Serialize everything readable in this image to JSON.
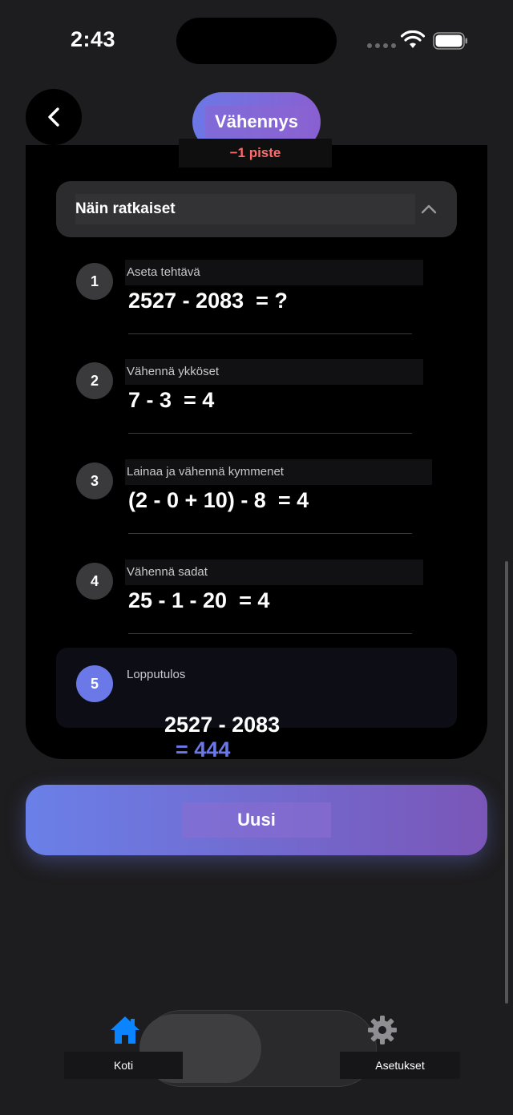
{
  "status_bar": {
    "time": "2:43"
  },
  "header": {
    "title": "Vähennys",
    "penalty": "−1 piste"
  },
  "solution": {
    "accordion_title": "Näin ratkaiset",
    "steps": [
      {
        "number": "1",
        "label": "Aseta tehtävä",
        "equation": "2527 - 2083  = ?"
      },
      {
        "number": "2",
        "label": "Vähennä ykköset",
        "equation": "7 - 3  = 4"
      },
      {
        "number": "3",
        "label": "Lainaa ja vähennä kymmenet",
        "equation": "(2 - 0 + 10) - 8  = 4"
      },
      {
        "number": "4",
        "label": "Vähennä sadat",
        "equation": "25 - 1 - 20  = 4"
      }
    ],
    "final": {
      "number": "5",
      "label": "Lopputulos",
      "question": "2527 - 2083",
      "answer": "= 444"
    }
  },
  "actions": {
    "new_label": "Uusi"
  },
  "tabs": [
    {
      "label": "Koti",
      "icon": "home-icon",
      "active": true
    },
    {
      "label": "Asetukset",
      "icon": "gear-icon",
      "active": false
    }
  ],
  "colors": {
    "accent": "#6a78e8",
    "penalty": "#ff6a6a",
    "background": "#1d1d1f"
  }
}
